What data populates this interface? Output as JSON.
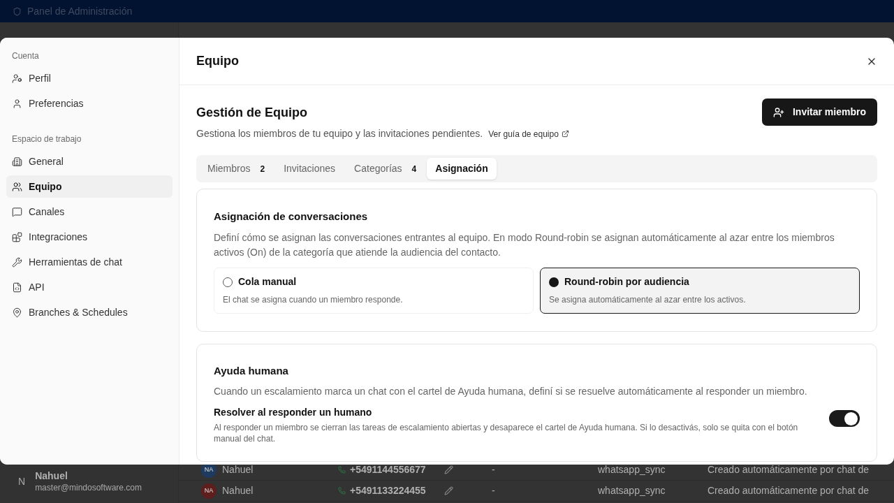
{
  "app_bar": {
    "title": "Panel de Administración"
  },
  "background": {
    "user": {
      "initial": "N",
      "name": "Nahuel",
      "email": "master@mindosoftware.com"
    },
    "rows": [
      {
        "avatar": "NA",
        "color": "#1e3a5f",
        "name": "Nahuel",
        "phone": "+5491144556677",
        "column_3": "-",
        "source": "whatsapp_sync",
        "note": "Creado automáticamente por chat de"
      },
      {
        "avatar": "NA",
        "color": "#5f1e1e",
        "name": "Nahuel",
        "phone": "+5491133224455",
        "column_3": "-",
        "source": "whatsapp_sync",
        "note": "Creado automáticamente por chat de"
      }
    ]
  },
  "modal": {
    "title": "Equipo",
    "sidebar": [
      {
        "title": "Cuenta",
        "items": [
          {
            "label": "Perfil",
            "selected": false
          },
          {
            "label": "Preferencias",
            "selected": false
          }
        ]
      },
      {
        "title": "Espacio de trabajo",
        "items": [
          {
            "label": "General",
            "selected": false
          },
          {
            "label": "Equipo",
            "selected": true
          },
          {
            "label": "Canales",
            "selected": false
          },
          {
            "label": "Integraciones",
            "selected": false
          },
          {
            "label": "Herramientas de chat",
            "selected": false
          },
          {
            "label": "API",
            "selected": false
          },
          {
            "label": "Branches & Schedules",
            "selected": false
          }
        ]
      }
    ],
    "heading": "Gestión de Equipo",
    "description": "Gestiona los miembros de tu equipo y las invitaciones pendientes.",
    "guide_link": "Ver guía de equipo",
    "invite_button": "Invitar miembro",
    "tabs": [
      {
        "label": "Miembros",
        "count": "2",
        "selected": false
      },
      {
        "label": "Invitaciones",
        "selected": false
      },
      {
        "label": "Categorías",
        "count": "4",
        "selected": false
      },
      {
        "label": "Asignación",
        "selected": true
      }
    ],
    "assignment": {
      "title": "Asignación de conversaciones",
      "description": "Definí cómo se asignan las conversaciones entrantes al equipo. En modo Round-robin se asignan automáticamente al azar entre los miembros activos (On) de la categoría que atiende la audiencia del contacto.",
      "options": [
        {
          "title": "Cola manual",
          "description": "El chat se asigna cuando un miembro responde.",
          "selected": false
        },
        {
          "title": "Round-robin por audiencia",
          "description": "Se asigna automáticamente al azar entre los activos.",
          "selected": true
        }
      ]
    },
    "human_help": {
      "title": "Ayuda humana",
      "description": "Cuando un escalamiento marca un chat con el cartel de Ayuda humana, definí si se resuelve automáticamente al responder un miembro.",
      "setting": {
        "label": "Resolver al responder un humano",
        "description": "Al responder un miembro se cierran las tareas de escalamiento abiertas y desaparece el cartel de Ayuda humana. Si lo desactivás, solo se quita con el botón manual del chat.",
        "on": true
      }
    }
  }
}
